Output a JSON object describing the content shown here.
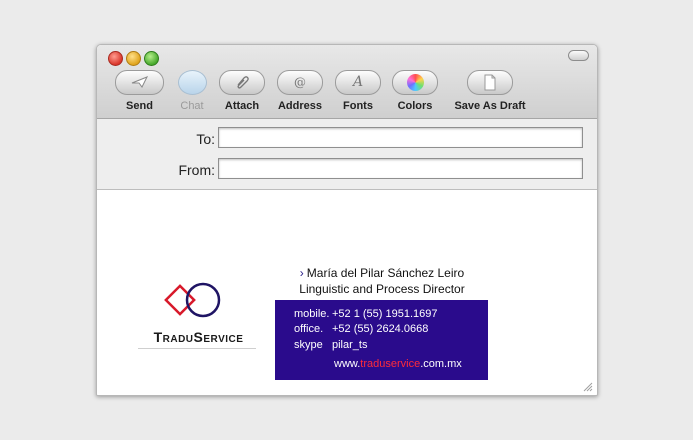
{
  "toolbar": {
    "send": "Send",
    "chat": "Chat",
    "attach": "Attach",
    "address": "Address",
    "fonts": "Fonts",
    "colors": "Colors",
    "save_draft": "Save As Draft"
  },
  "header": {
    "to_label": "To:",
    "to_value": "",
    "from_label": "From:",
    "from_value": ""
  },
  "signature": {
    "logo_text": "TraduService",
    "name": "María del Pilar Sánchez Leiro",
    "role": "Linguistic and Process Director",
    "mobile_label": "mobile.",
    "mobile_value": "+52 1 (55) 1951.1697",
    "office_label": "office.",
    "office_value": "+52  (55) 2624.0668",
    "skype_label": "skype",
    "skype_value": "pilar_ts",
    "web_prefix": "www.",
    "web_highlight": "traduservice",
    "web_suffix": ".com.mx"
  },
  "colors": {
    "accent_box": "#2a0b8c",
    "logo_red": "#d8192a",
    "logo_navy": "#1f1464"
  }
}
